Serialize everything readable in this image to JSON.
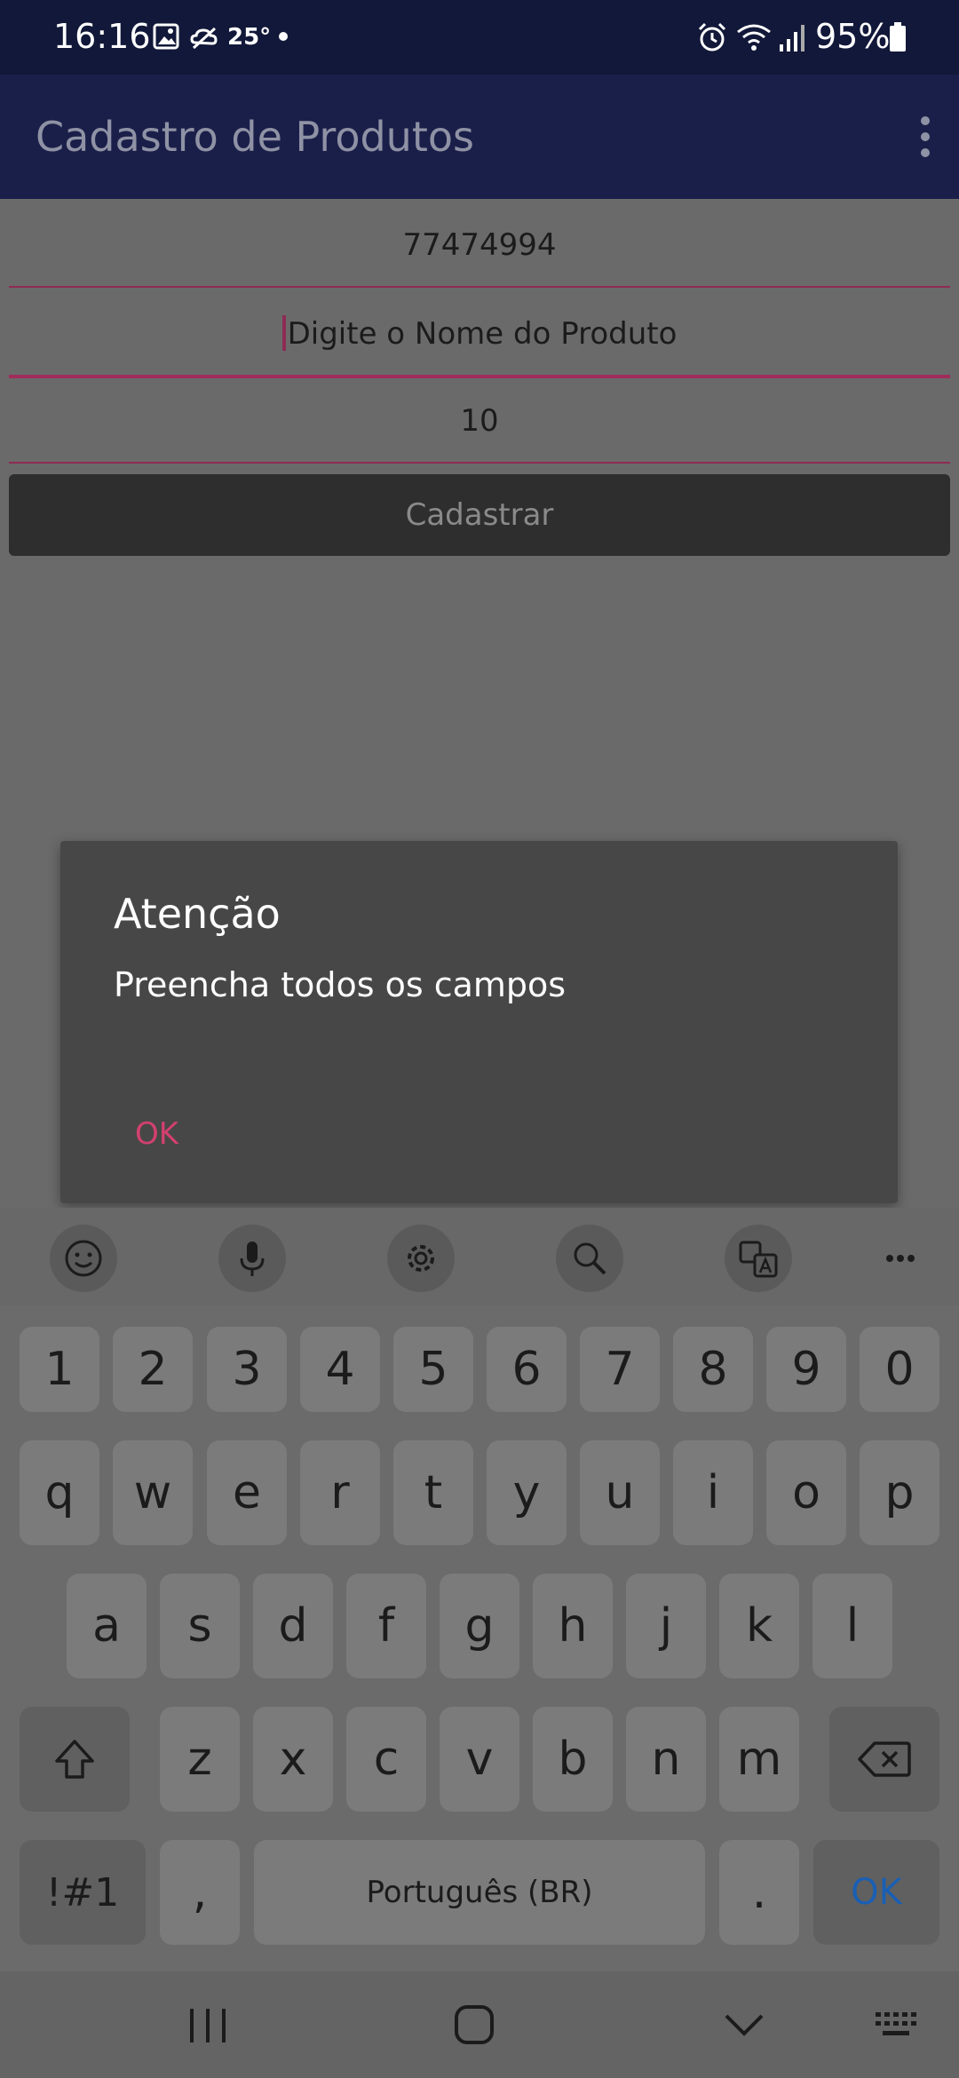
{
  "status_bar": {
    "time": "16:16",
    "temperature": "25°",
    "battery": "95%"
  },
  "app_bar": {
    "title": "Cadastro de Produtos"
  },
  "form": {
    "code_value": "77474994",
    "name_placeholder": "Digite o Nome do Produto",
    "quantity_value": "10",
    "submit_label": "Cadastrar"
  },
  "dialog": {
    "title": "Atenção",
    "message": "Preencha todos os campos",
    "ok_label": "OK"
  },
  "keyboard": {
    "number_row": [
      "1",
      "2",
      "3",
      "4",
      "5",
      "6",
      "7",
      "8",
      "9",
      "0"
    ],
    "row1": [
      "q",
      "w",
      "e",
      "r",
      "t",
      "y",
      "u",
      "i",
      "o",
      "p"
    ],
    "row2": [
      "a",
      "s",
      "d",
      "f",
      "g",
      "h",
      "j",
      "k",
      "l"
    ],
    "row3": [
      "z",
      "x",
      "c",
      "v",
      "b",
      "n",
      "m"
    ],
    "symbols_label": "!#1",
    "comma_label": ",",
    "space_label": "Português (BR)",
    "period_label": ".",
    "ok_label": "OK"
  },
  "colors": {
    "status_bar": "#121839",
    "app_bar": "#1a1f4a",
    "accent": "#d3406f",
    "keyboard_ok": "#1a5fb4"
  }
}
